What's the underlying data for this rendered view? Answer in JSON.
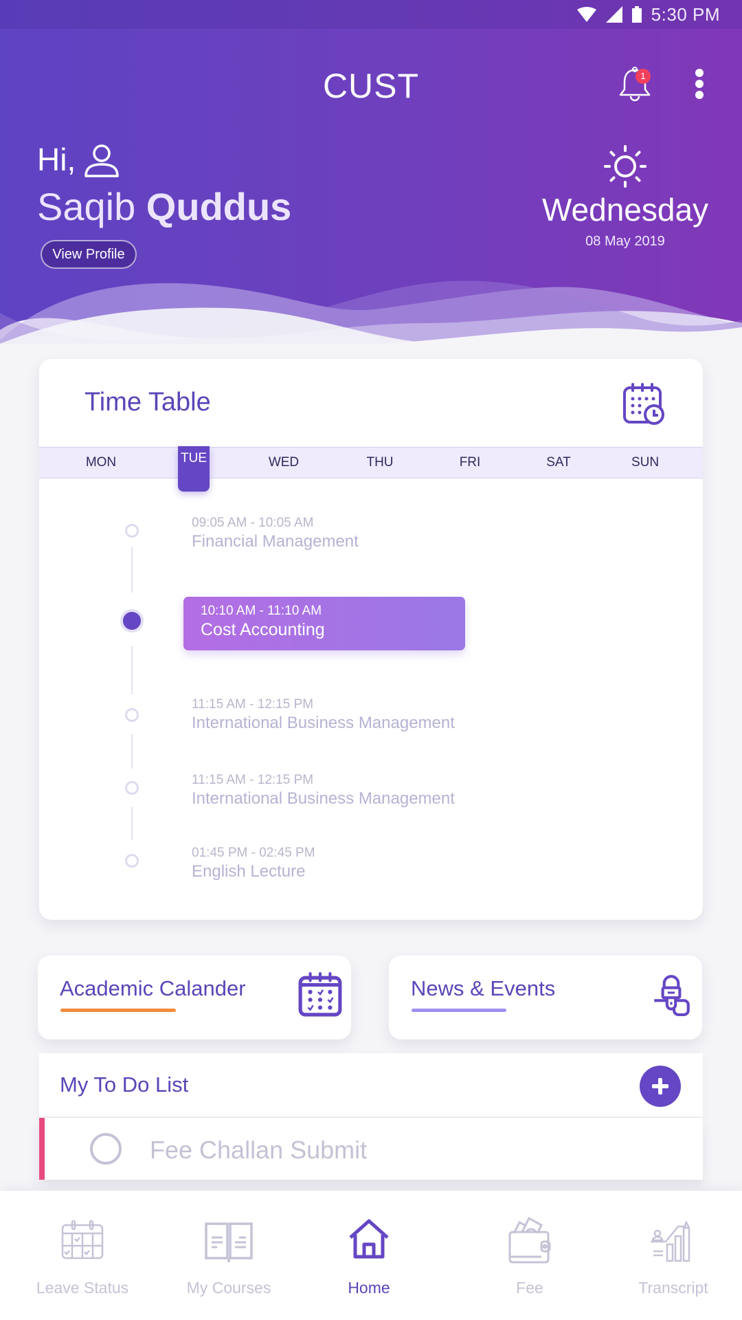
{
  "status_bar": {
    "time": "5:30 PM",
    "icons": [
      "wifi-icon",
      "signal-icon",
      "battery-icon"
    ]
  },
  "header": {
    "title": "CUST",
    "notification_count": "1",
    "greeting": "Hi,",
    "first_name": "Saqib",
    "last_name": "Quddus",
    "view_profile_label": "View Profile",
    "weather_icon": "sun-icon",
    "day": "Wednesday",
    "date": "08 May 2019"
  },
  "timetable": {
    "title": "Time Table",
    "days": [
      {
        "label": "MON",
        "active": false
      },
      {
        "label": "TUE",
        "active": true
      },
      {
        "label": "WED",
        "active": false
      },
      {
        "label": "THU",
        "active": false
      },
      {
        "label": "FRI",
        "active": false
      },
      {
        "label": "SAT",
        "active": false
      },
      {
        "label": "SUN",
        "active": false
      }
    ],
    "classes": [
      {
        "time": "09:05 AM - 10:05 AM",
        "course": "Financial Management",
        "active": false
      },
      {
        "time": "10:10 AM - 11:10 AM",
        "course": "Cost Accounting",
        "active": true
      },
      {
        "time": "11:15 AM - 12:15 PM",
        "course": "International Business Management",
        "active": false
      },
      {
        "time": "11:15 AM - 12:15 PM",
        "course": "International Business Management",
        "active": false
      },
      {
        "time": "01:45 PM - 02:45 PM",
        "course": "English Lecture",
        "active": false
      }
    ]
  },
  "shortcuts": [
    {
      "label": "Academic Calander",
      "accent": "#f38b3c",
      "icon": "calendar-check-icon"
    },
    {
      "label": "News & Events",
      "accent": "#a08ef2",
      "icon": "microphone-icon"
    }
  ],
  "todo": {
    "title": "My To Do List",
    "items": [
      {
        "text": "Fee Challan Submit",
        "done": false,
        "priority_color": "#e64c82"
      }
    ]
  },
  "bottom_nav": [
    {
      "label": "Leave Status",
      "icon": "calendar-icon",
      "active": false
    },
    {
      "label": "My Courses",
      "icon": "book-icon",
      "active": false
    },
    {
      "label": "Home",
      "icon": "home-icon",
      "active": true
    },
    {
      "label": "Fee",
      "icon": "wallet-icon",
      "active": false
    },
    {
      "label": "Transcript",
      "icon": "chart-growth-icon",
      "active": false
    }
  ],
  "colors": {
    "primary": "#6546c4",
    "header_gradient_start": "#5b42c0",
    "header_gradient_end": "#8138b8",
    "inactive": "#c4c3d6"
  }
}
